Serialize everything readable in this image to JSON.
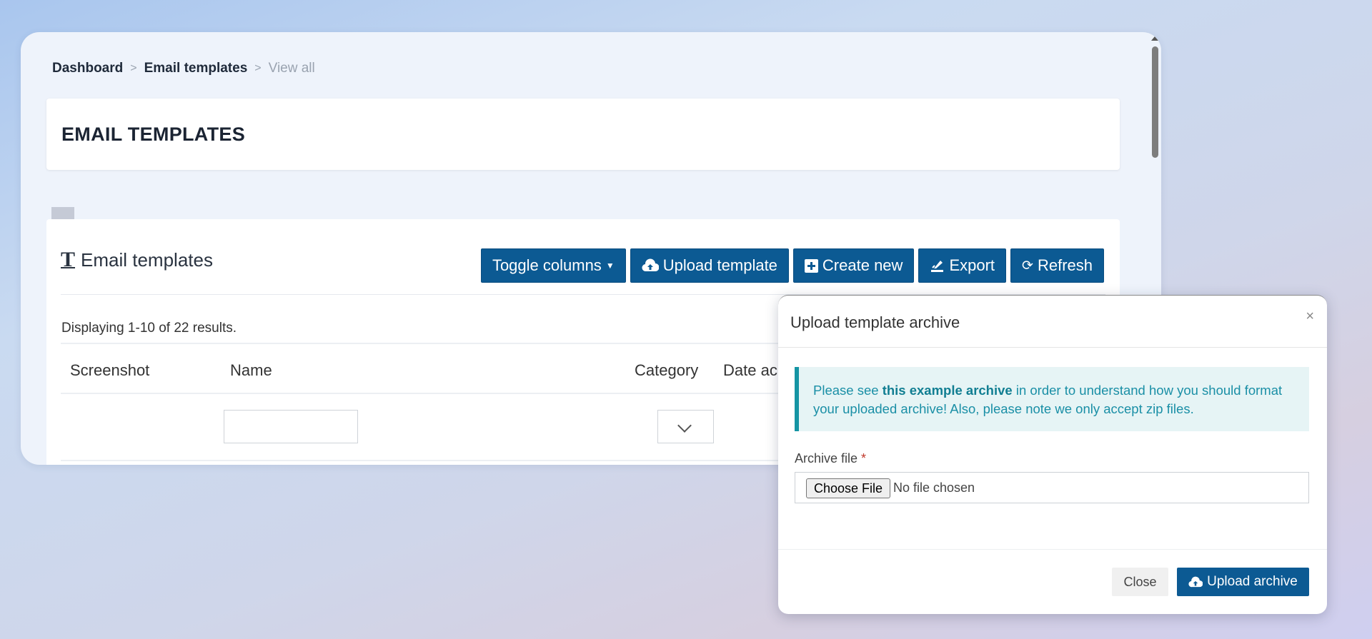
{
  "breadcrumb": {
    "dashboard": "Dashboard",
    "email_templates": "Email templates",
    "current": "View all",
    "separator": ">"
  },
  "page": {
    "title": "EMAIL TEMPLATES"
  },
  "grid": {
    "title": "Email templates",
    "toolbar": {
      "toggle_columns": "Toggle columns",
      "upload_template": "Upload template",
      "create_new": "Create new",
      "export": "Export",
      "refresh": "Refresh"
    },
    "summary": "Displaying 1-10 of 22 results.",
    "columns": [
      "Screenshot",
      "Name",
      "Category",
      "Date ac"
    ],
    "filters": {
      "name": "",
      "category": ""
    }
  },
  "modal": {
    "title": "Upload template archive",
    "close_x": "×",
    "alert": {
      "before": "Please see ",
      "link": "this example archive",
      "after": " in order to understand how you should format your uploaded archive! Also, please note we only accept zip files."
    },
    "field_label": "Archive file",
    "required_mark": "*",
    "choose_file": "Choose File",
    "no_file": "No file chosen",
    "close_button": "Close",
    "upload_button": "Upload archive"
  },
  "colors": {
    "primary": "#0c5a93",
    "alert_bg": "#e6f4f5",
    "alert_text": "#1a8fa6"
  }
}
